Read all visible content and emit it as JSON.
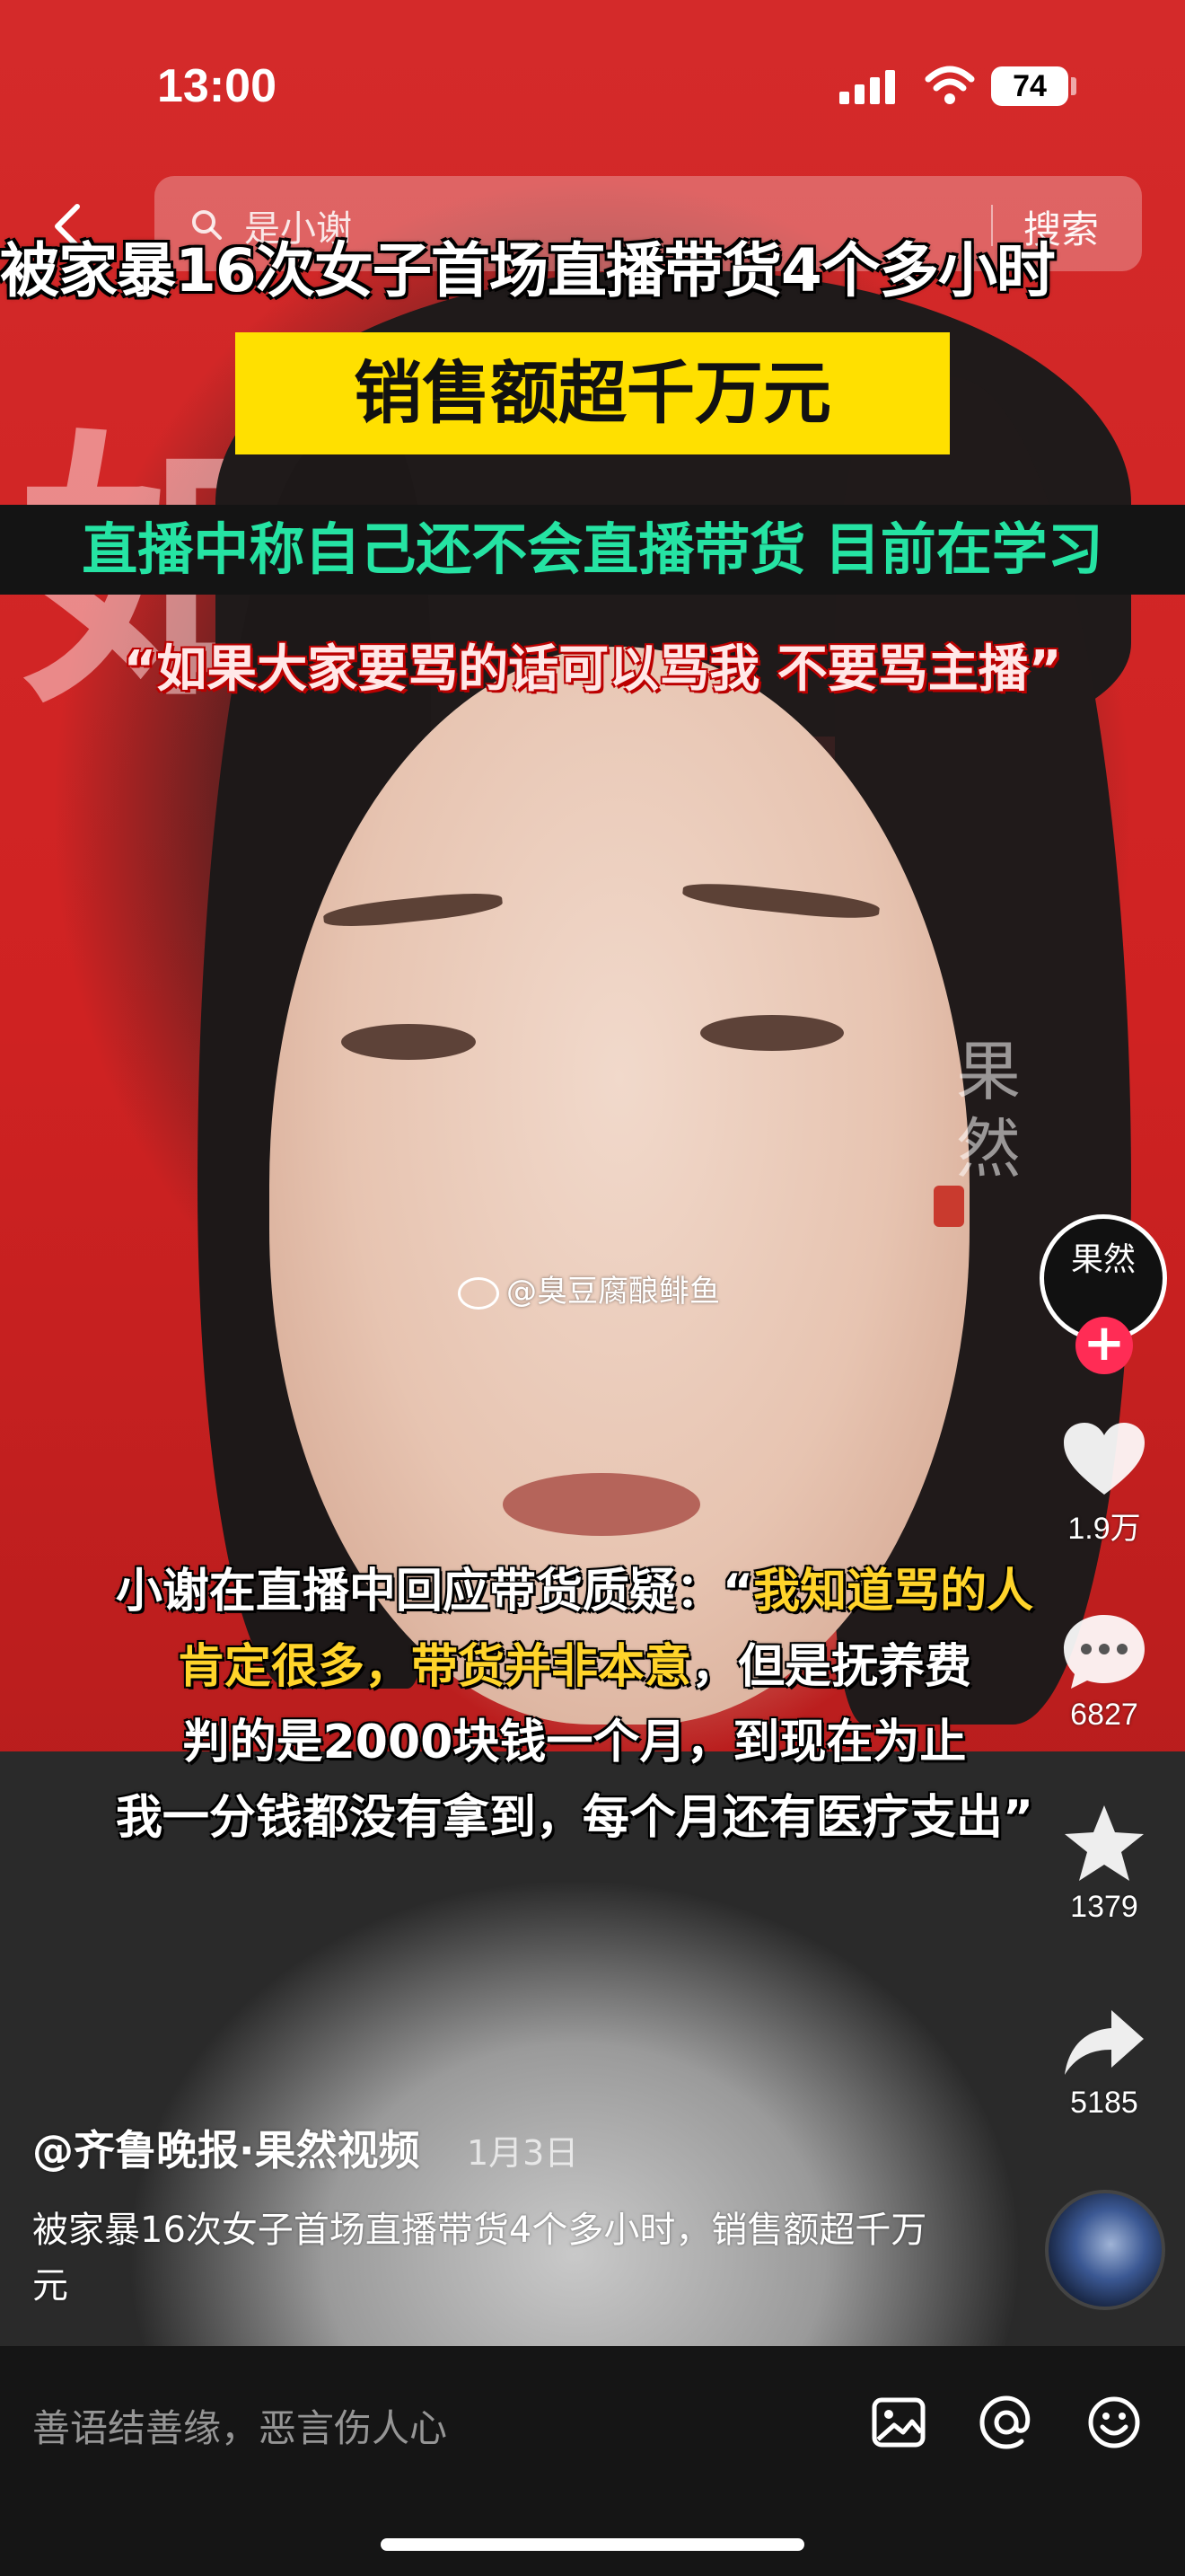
{
  "status_bar": {
    "time": "13:00",
    "battery": "74"
  },
  "search": {
    "query": "是小谢",
    "button": "搜索"
  },
  "video": {
    "caption_title": "被家暴16次女子首场直播带货4个多小时",
    "caption_highlight": "销售额超千万元",
    "caption_band": "直播中称自己还不会直播带货 目前在学习",
    "caption_quote": "“如果大家要骂的话可以骂我 不要骂主播”",
    "watermark": "@臭豆腐酿鲱鱼",
    "logo_text": "果\n然",
    "subtitle": {
      "l1_white": "小谢在直播中回应带货质疑：“",
      "l1_yellow": "我知道骂的人",
      "l2_yellow": "肯定很多，带货并非本意",
      "l2_white": "，但是抚养费",
      "l3": "判的是2000块钱一个月，到现在为止",
      "l4": "我一分钱都没有拿到，每个月还有医疗支出”"
    }
  },
  "actions": {
    "avatar_text": "果然",
    "like_count": "1.9万",
    "comment_count": "6827",
    "favorite_count": "1379",
    "share_count": "5185"
  },
  "post": {
    "author": "@齐鲁晚报·果然视频",
    "date": "1月3日",
    "description": "被家暴16次女子首场直播带货4个多小时，销售额超千万元"
  },
  "bottom_bar": {
    "comment_placeholder": "善语结善缘，恶言伤人心"
  },
  "colors": {
    "accent_red": "#ff2c55",
    "caption_yellow": "#ffe000",
    "caption_green": "#25e3a3"
  }
}
